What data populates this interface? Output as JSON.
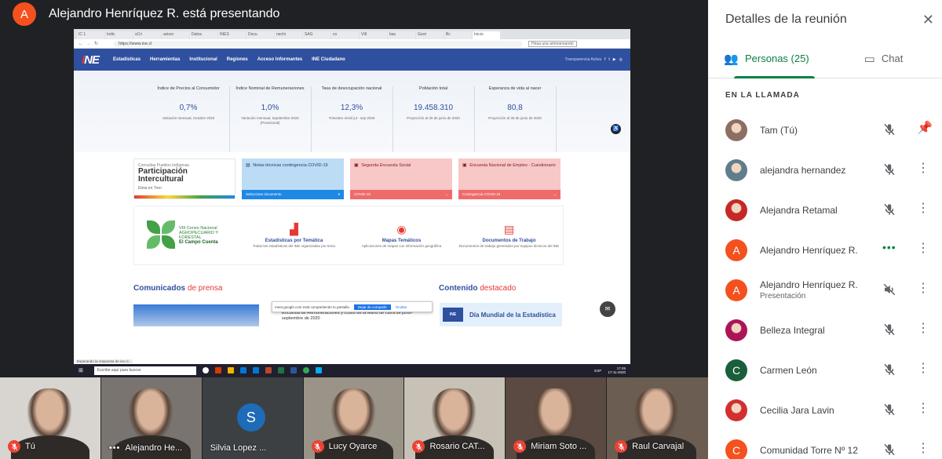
{
  "presenter": {
    "avatar_letter": "A",
    "text": "Alejandro Henríquez R. está presentando"
  },
  "shared_screen": {
    "address": "https://www.ine.cl",
    "find_box": "Hiraa una ammannando",
    "tabs": [
      "IC 1",
      "Indic",
      "sCri",
      "avisor",
      "Datos",
      "INES",
      "Docu",
      "nechi",
      "SAG",
      "co",
      "VIII",
      "bas",
      "Geot",
      "Bc",
      "Inicio"
    ],
    "nav": [
      "Estadísticas",
      "Herramientas",
      "Institucional",
      "Regiones",
      "Acceso Informantes",
      "INE Ciudadano"
    ],
    "transparencia": "Transparencia Activa",
    "logo": "INE",
    "stats": [
      {
        "title": "Índice de Precios al Consumidor",
        "value": "0,7%",
        "note": "Variación mensual, Octubre 2020"
      },
      {
        "title": "Índice Nominal de Remuneraciones",
        "value": "1,0%",
        "note": "Variación mensual, Septiembre 2020 (Provisional)"
      },
      {
        "title": "Tasa de desocupación nacional",
        "value": "12,3%",
        "note": "Trimestre móvil jul - sep 2020"
      },
      {
        "title": "Población total",
        "value": "19.458.310",
        "note": "Proyección al 30 de junio de 2020"
      },
      {
        "title": "Esperanza de vida al nacer",
        "value": "80,8",
        "note": "Proyección al 30 de junio de 2020"
      }
    ],
    "cards": {
      "participacion_line": "Consultas Pueblos Indígenas",
      "participacion_big": "Participación Intercultural",
      "participacion_tag": "Etnia en Tren",
      "notas_title": "Notas técnicas contingencia COVID-19",
      "notas_footer": "Seleccione documento",
      "segunda_title": "Segunda Encuesta Social",
      "segunda_footer": "COVID-19",
      "empleo_title": "Encuesta Nacional de Empleo - Cuestionario",
      "empleo_footer": "Contingencia COVID-19"
    },
    "censo": {
      "line1": "VIII Censo Nacional",
      "line2": "AGROPECUARIO Y FORESTAL",
      "line3": "El Campo Cuenta"
    },
    "temas": [
      {
        "icon": "bar-chart-icon",
        "glyph": "▟",
        "title": "Estadísticas por Temática",
        "sub": "Todas las estadísticas del INE organizadas por tema"
      },
      {
        "icon": "map-pin-icon",
        "glyph": "◉",
        "title": "Mapas Temáticos",
        "sub": "Aplicaciones de mapas con información geográfica"
      },
      {
        "icon": "document-icon",
        "glyph": "▤",
        "title": "Documentos de Trabajo",
        "sub": "Documentos de trabajo generados por equipos técnicos del INE"
      }
    ],
    "comunicados": "Comunicados",
    "comunicados_sub": "de prensa",
    "contenido": "Contenido",
    "contenido_sub": "destacado",
    "press_text": "Encuesta de Remuneraciones y Costo de la Mano de Obra de junio-septiembre de 2020",
    "share_bar": {
      "text": "meet.google.com está compartiendo tu pantalla",
      "stop": "Dejar de compartir",
      "hide": "Ocultar"
    },
    "mundial": "Día Mundial de la Estadística",
    "status": "Esperando la respuesta de ine.cl...",
    "win_search": "Escribe aquí para buscar",
    "clock_time": "17:45",
    "clock_date": "17-11-2020",
    "lang": "ESP"
  },
  "panel": {
    "title": "Detalles de la reunión",
    "tab_people": "Personas (25)",
    "tab_chat": "Chat",
    "section": "EN LA LLAMADA",
    "people": [
      {
        "name": "Tam (Tú)",
        "sub": "",
        "avatar": "photo",
        "color": "#8d6e63",
        "letter": "",
        "state": "muted",
        "action": "pin"
      },
      {
        "name": "alejandra hernandez",
        "sub": "",
        "avatar": "photo",
        "color": "#607d8b",
        "letter": "",
        "state": "muted",
        "action": "more"
      },
      {
        "name": "Alejandra Retamal",
        "sub": "",
        "avatar": "photo",
        "color": "#c62828",
        "letter": "",
        "state": "muted",
        "action": "more"
      },
      {
        "name": "Alejandro Henríquez R.",
        "sub": "",
        "avatar": "letter",
        "color": "#f4511e",
        "letter": "A",
        "state": "speaking",
        "action": "more"
      },
      {
        "name": "Alejandro Henríquez R.",
        "sub": "Presentación",
        "avatar": "letter",
        "color": "#f4511e",
        "letter": "A",
        "state": "audio-off",
        "action": "more"
      },
      {
        "name": "Belleza Integral",
        "sub": "",
        "avatar": "photo",
        "color": "#ad1457",
        "letter": "",
        "state": "muted",
        "action": "more"
      },
      {
        "name": "Carmen León",
        "sub": "",
        "avatar": "letter",
        "color": "#1b5e3b",
        "letter": "C",
        "state": "muted",
        "action": "more"
      },
      {
        "name": "Cecilia Jara Lavin",
        "sub": "",
        "avatar": "photo",
        "color": "#d32f2f",
        "letter": "",
        "state": "muted",
        "action": "more"
      },
      {
        "name": "Comunidad Torre Nº 12",
        "sub": "",
        "avatar": "letter",
        "color": "#f4511e",
        "letter": "C",
        "state": "muted",
        "action": "more"
      }
    ]
  },
  "tiles": [
    {
      "name": "Tú",
      "mic": "muted",
      "bg": "#d8d4cf"
    },
    {
      "name": "Alejandro He...",
      "mic": "speaking",
      "bg": "#7a7470"
    },
    {
      "name": "Silvia Lopez ...",
      "mic": "none",
      "bg": "#3c4043",
      "letter": "S"
    },
    {
      "name": "Lucy Oyarce",
      "mic": "muted",
      "bg": "#9a9488"
    },
    {
      "name": "Rosario CAT...",
      "mic": "muted",
      "bg": "#c8c2b6"
    },
    {
      "name": "Miriam Soto ...",
      "mic": "muted",
      "bg": "#5a4a42"
    },
    {
      "name": "Raul Carvajal",
      "mic": "muted",
      "bg": "#6b5d52"
    }
  ]
}
